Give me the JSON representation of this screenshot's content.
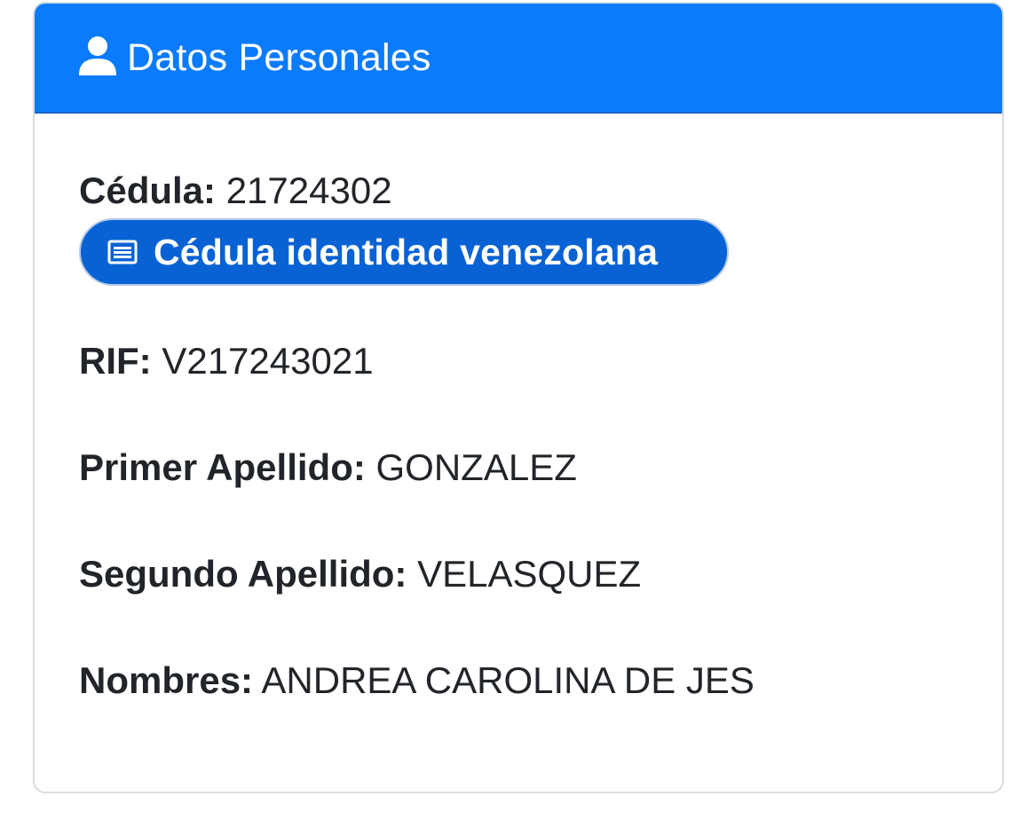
{
  "card": {
    "header": {
      "icon": "user-icon",
      "title": "Datos Personales",
      "background_color": "#0a7bfb"
    },
    "fields": {
      "cedula": {
        "label": "Cédula:",
        "value": "21724302"
      },
      "cedula_badge": {
        "icon": "id-card-icon",
        "text": "Cédula identidad venezolana",
        "background_color": "#0862d4"
      },
      "rif": {
        "label": "RIF:",
        "value": "V217243021"
      },
      "primer_apellido": {
        "label": "Primer Apellido:",
        "value": "GONZALEZ"
      },
      "segundo_apellido": {
        "label": "Segundo Apellido:",
        "value": "VELASQUEZ"
      },
      "nombres": {
        "label": "Nombres:",
        "value": "ANDREA CAROLINA DE JES"
      }
    }
  }
}
